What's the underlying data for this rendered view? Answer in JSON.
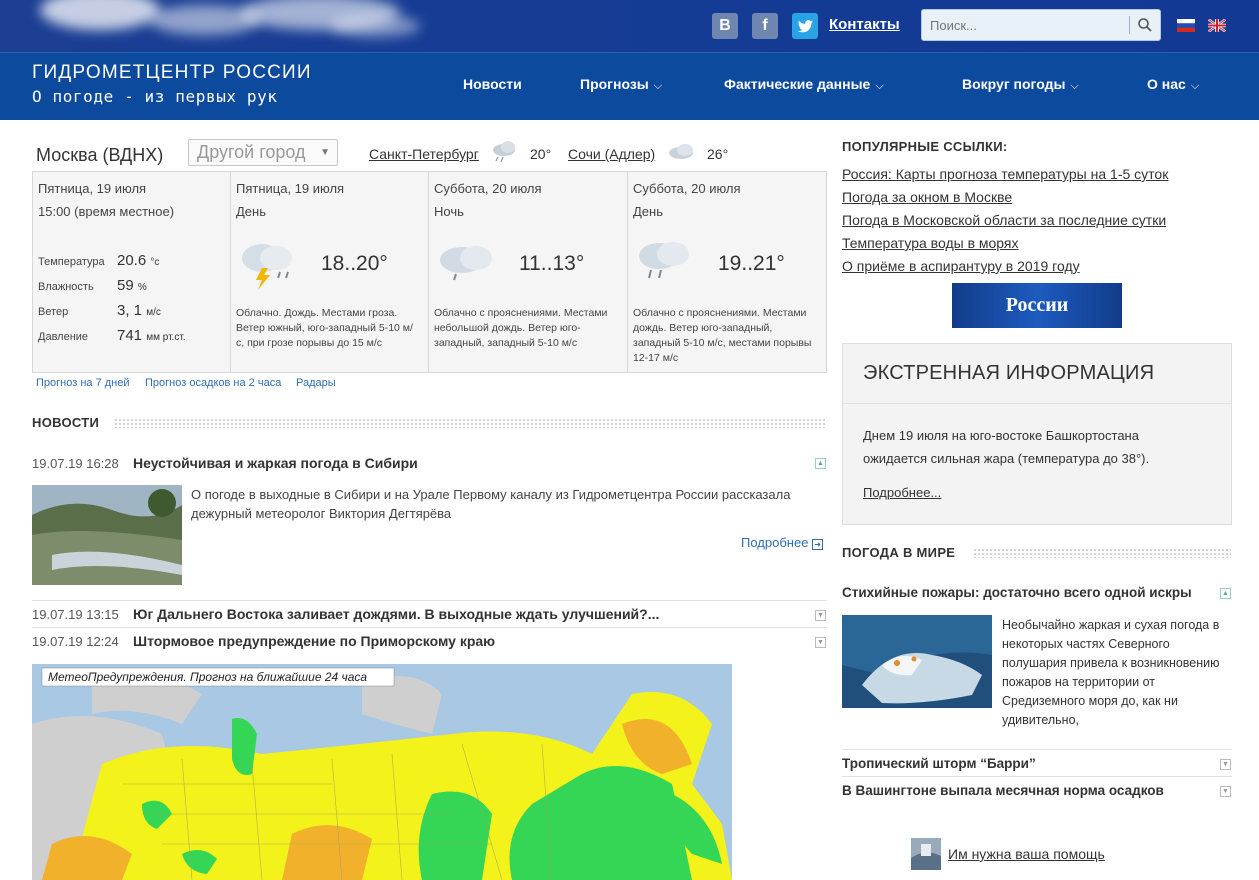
{
  "topbar": {
    "social": {
      "vk": "B",
      "fb": "f",
      "tw": "twitter-icon"
    },
    "contacts": "Контакты",
    "search_placeholder": "Поиск..."
  },
  "logo": {
    "title": "ГИДРОМЕТЦЕНТР РОССИИ",
    "subtitle": "О погоде - из первых рук"
  },
  "nav": {
    "news": "Новости",
    "forecasts": "Прогнозы",
    "actual": "Фактические данные",
    "around": "Вокруг погоды",
    "about": "О нас",
    "chevron": "⌵"
  },
  "weather": {
    "city": "Москва (ВДНХ)",
    "city_select": "Другой город",
    "others": [
      {
        "name": "Санкт-Петербург",
        "temp": "20°"
      },
      {
        "name": "Сочи (Адлер)",
        "temp": "26°"
      }
    ],
    "current": {
      "date": "Пятница, 19 июля",
      "time": "15:00 (время местное)",
      "params": [
        {
          "label": "Температура",
          "value": "20.6",
          "unit": "°с"
        },
        {
          "label": "Влажность",
          "value": "59",
          "unit": "%"
        },
        {
          "label": "Ветер",
          "value": "3, 1",
          "unit": "м/с"
        },
        {
          "label": "Давление",
          "value": "741",
          "unit": "мм рт.ст."
        }
      ]
    },
    "forecast": [
      {
        "date": "Пятница, 19 июля",
        "part": "День",
        "temp": "18..20°",
        "desc": "Облачно. Дождь. Местами гроза. Ветер южный, юго-западный 5-10 м/с, при грозе порывы до 15 м/с"
      },
      {
        "date": "Суббота, 20 июля",
        "part": "Ночь",
        "temp": "11..13°",
        "desc": "Облачно с прояснениями. Местами небольшой дождь. Ветер юго-западный, западный 5-10 м/с"
      },
      {
        "date": "Суббота, 20 июля",
        "part": "День",
        "temp": "19..21°",
        "desc": "Облачно с прояснениями. Местами дождь. Ветер юго-западный, западный 5-10 м/с, местами порывы 12-17 м/с"
      }
    ],
    "links": [
      "Прогноз на 7 дней",
      "Прогноз осадков на 2 часа",
      "Радары"
    ]
  },
  "news": {
    "title": "НОВОСТИ",
    "items": [
      {
        "time": "19.07.19 16:28",
        "head": "Неустойчивая и жаркая погода в Сибири",
        "text": "О погоде в выходные в Сибири и на Урале Первому каналу из Гидрометцентра России рассказала дежурный метеоролог Виктория Дегтярёва",
        "more": "Подробнее"
      },
      {
        "time": "19.07.19 13:15",
        "head": "Юг Дальнего Востока заливает дождями. В выходные ждать улучшений?..."
      },
      {
        "time": "19.07.19 12:24",
        "head": "Штормовое предупреждение по Приморскому краю"
      }
    ],
    "map_caption": "МетеоПредупреждения. Прогноз на ближайшие 24 часа"
  },
  "popular": {
    "title": "ПОПУЛЯРНЫЕ ССЫЛКИ:",
    "links": [
      "Россия: Карты прогноза температуры на 1-5 суток",
      "Погода за окном в Москве",
      "Погода в Московской области за последние сутки",
      "Температура воды в морях",
      "О приёме в аспирантуру в 2019 году"
    ],
    "banner": "России"
  },
  "emergency": {
    "title": "ЭКСТРЕННАЯ ИНФОРМАЦИЯ",
    "text": "Днем 19 июля на юго-востоке Башкортостана ожидается сильная жара (температура до 38°).",
    "more": "Подробнее..."
  },
  "world": {
    "title": "ПОГОДА В МИРЕ",
    "items": [
      {
        "head": "Стихийные пожары: достаточно всего одной искры",
        "text": "Необычайно жаркая и сухая погода в некоторых частях Северного полушария привела к возникновению пожаров на территории от Средиземного моря до, как ни удивительно,"
      },
      {
        "head": "Тропический шторм “Барри”"
      },
      {
        "head": "В Вашингтоне выпала месячная норма осадков"
      }
    ],
    "help": "Им нужна ваша помощь"
  },
  "colors": {
    "header": "#0c4a9e",
    "topbar": "#163c94",
    "link_blue": "#2f6db2",
    "warn_yellow": "#f3f21a",
    "warn_green": "#35d655",
    "warn_orange": "#f2b12b"
  }
}
